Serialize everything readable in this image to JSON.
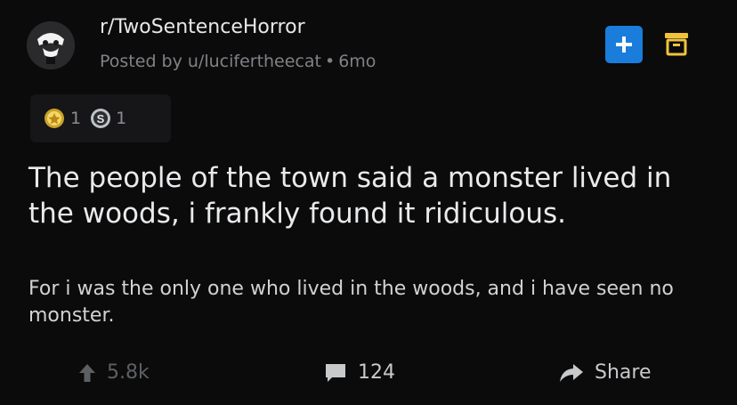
{
  "post": {
    "subreddit": "r/TwoSentenceHorror",
    "posted_by": "Posted by u/lucifertheecat",
    "separator": "•",
    "age": "6mo",
    "awards": [
      {
        "icon": "silver-award-icon",
        "count": "1"
      },
      {
        "icon": "coin-award-icon",
        "count": "1"
      }
    ],
    "title": "The people of the town said a monster lived in the woods, i frankly found it ridiculous.",
    "body": "For i was the only one who lived in the woods, and i have seen no monster."
  },
  "header_actions": {
    "join_icon": "plus-icon",
    "archive_icon": "archive-icon",
    "join_color": "#1a7ddc"
  },
  "footer": {
    "upvotes": "5.8k",
    "comments": "124",
    "share": "Share"
  },
  "colors": {
    "background": "#0b0b0c",
    "text": "#e9eaeb",
    "muted": "#7f8285",
    "archive_icon": "#f0c33c"
  }
}
